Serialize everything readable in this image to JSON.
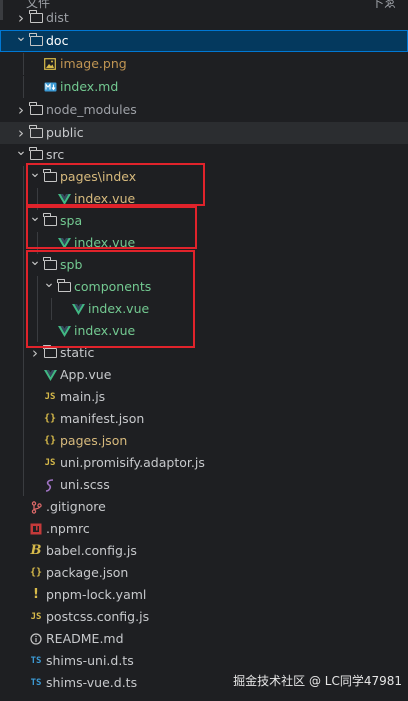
{
  "top_fragment": "文件",
  "top_fragment_right": "卜ゑ",
  "tree": [
    {
      "label": "dist",
      "type": "folder",
      "expanded": false,
      "color": "#9da0a6"
    },
    {
      "label": "doc",
      "type": "folder",
      "expanded": true,
      "selected": true
    },
    {
      "label": "image.png",
      "type": "image",
      "color": "#c09553"
    },
    {
      "label": "index.md",
      "type": "markdown",
      "color": "#73c991"
    },
    {
      "label": "node_modules",
      "type": "folder",
      "expanded": false,
      "color": "#9da0a6"
    },
    {
      "label": "public",
      "type": "folder",
      "expanded": false,
      "hover": true
    },
    {
      "label": "src",
      "type": "folder",
      "expanded": true
    },
    {
      "label": "pages\\index",
      "type": "folder",
      "expanded": true,
      "color": "#d7ba7d"
    },
    {
      "label": "index.vue",
      "type": "vue",
      "color": "#d7ba7d"
    },
    {
      "label": "spa",
      "type": "folder",
      "expanded": true,
      "color": "#73c991"
    },
    {
      "label": "index.vue",
      "type": "vue",
      "color": "#73c991"
    },
    {
      "label": "spb",
      "type": "folder",
      "expanded": true,
      "color": "#73c991"
    },
    {
      "label": "components",
      "type": "folder",
      "expanded": true,
      "color": "#73c991"
    },
    {
      "label": "index.vue",
      "type": "vue",
      "color": "#73c991"
    },
    {
      "label": "index.vue",
      "type": "vue",
      "color": "#73c991"
    },
    {
      "label": "static",
      "type": "folder",
      "expanded": false
    },
    {
      "label": "App.vue",
      "type": "vue"
    },
    {
      "label": "main.js",
      "type": "js"
    },
    {
      "label": "manifest.json",
      "type": "json"
    },
    {
      "label": "pages.json",
      "type": "json",
      "color": "#d7ba7d"
    },
    {
      "label": "uni.promisify.adaptor.js",
      "type": "js"
    },
    {
      "label": "uni.scss",
      "type": "scss"
    },
    {
      "label": ".gitignore",
      "type": "git"
    },
    {
      "label": ".npmrc",
      "type": "npm"
    },
    {
      "label": "babel.config.js",
      "type": "babel"
    },
    {
      "label": "package.json",
      "type": "json"
    },
    {
      "label": "pnpm-lock.yaml",
      "type": "yaml"
    },
    {
      "label": "postcss.config.js",
      "type": "js"
    },
    {
      "label": "README.md",
      "type": "info"
    },
    {
      "label": "shims-uni.d.ts",
      "type": "ts"
    },
    {
      "label": "shims-vue.d.ts",
      "type": "ts"
    }
  ],
  "icon_glyphs": {
    "js": "JS",
    "ts": "TS",
    "json": "{}",
    "yaml": "!"
  },
  "watermark": "掘金技术社区 @ LC同学47981",
  "colors": {
    "background": "#1e1f22",
    "selection": "#04395e",
    "selection_border": "#0078d4",
    "highlight_box": "#e0232b",
    "modified_green": "#73c991",
    "modified_yellow": "#d7ba7d"
  }
}
